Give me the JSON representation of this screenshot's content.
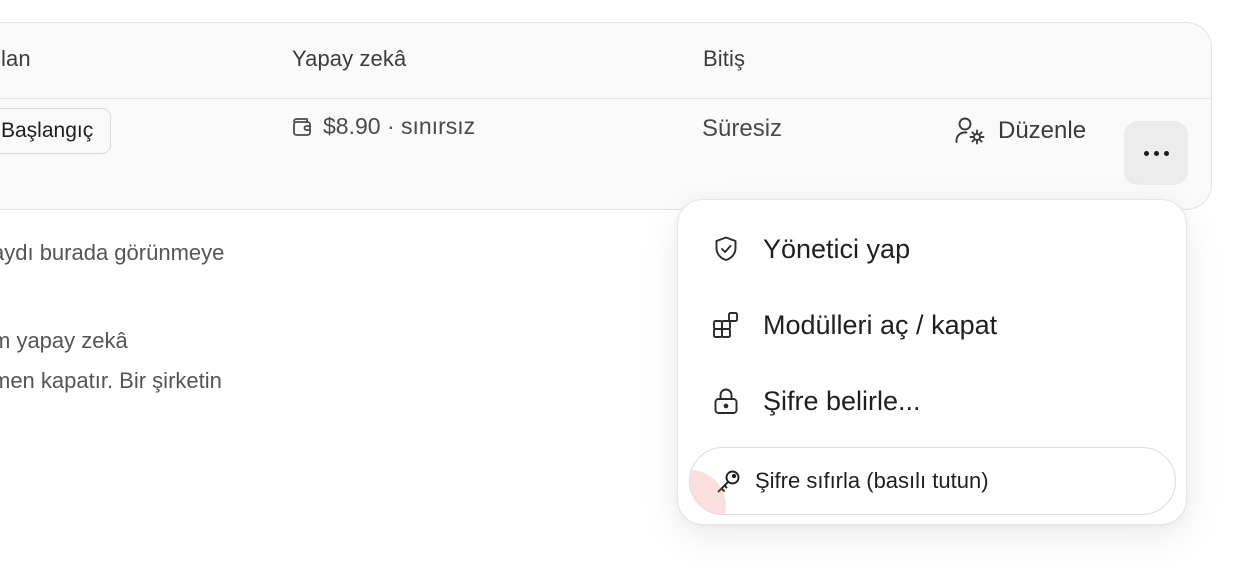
{
  "table": {
    "headers": {
      "plan": "lan",
      "ai": "Yapay zekâ",
      "end": "Bitiş"
    },
    "row": {
      "plan_badge": "Başlangıç",
      "ai_value": "$8.90 · sınırsız",
      "end_value": "Süresiz",
      "edit_label": "Düzenle"
    }
  },
  "background_text": {
    "line1": "aydı burada görünmeye",
    "line2": "m yapay zekâ",
    "line3": "men kapatır. Bir şirketin"
  },
  "menu": {
    "items": [
      {
        "label": "Yönetici yap",
        "icon": "shield-check-icon"
      },
      {
        "label": "Modülleri aç / kapat",
        "icon": "modules-grid-icon"
      },
      {
        "label": "Şifre belirle...",
        "icon": "lock-icon"
      },
      {
        "label": "Şifre sıfırla (basılı tutun)",
        "icon": "key-icon"
      }
    ]
  },
  "colors": {
    "hold_progress": "#ec6e6e",
    "more_button_bg": "#ececec"
  }
}
